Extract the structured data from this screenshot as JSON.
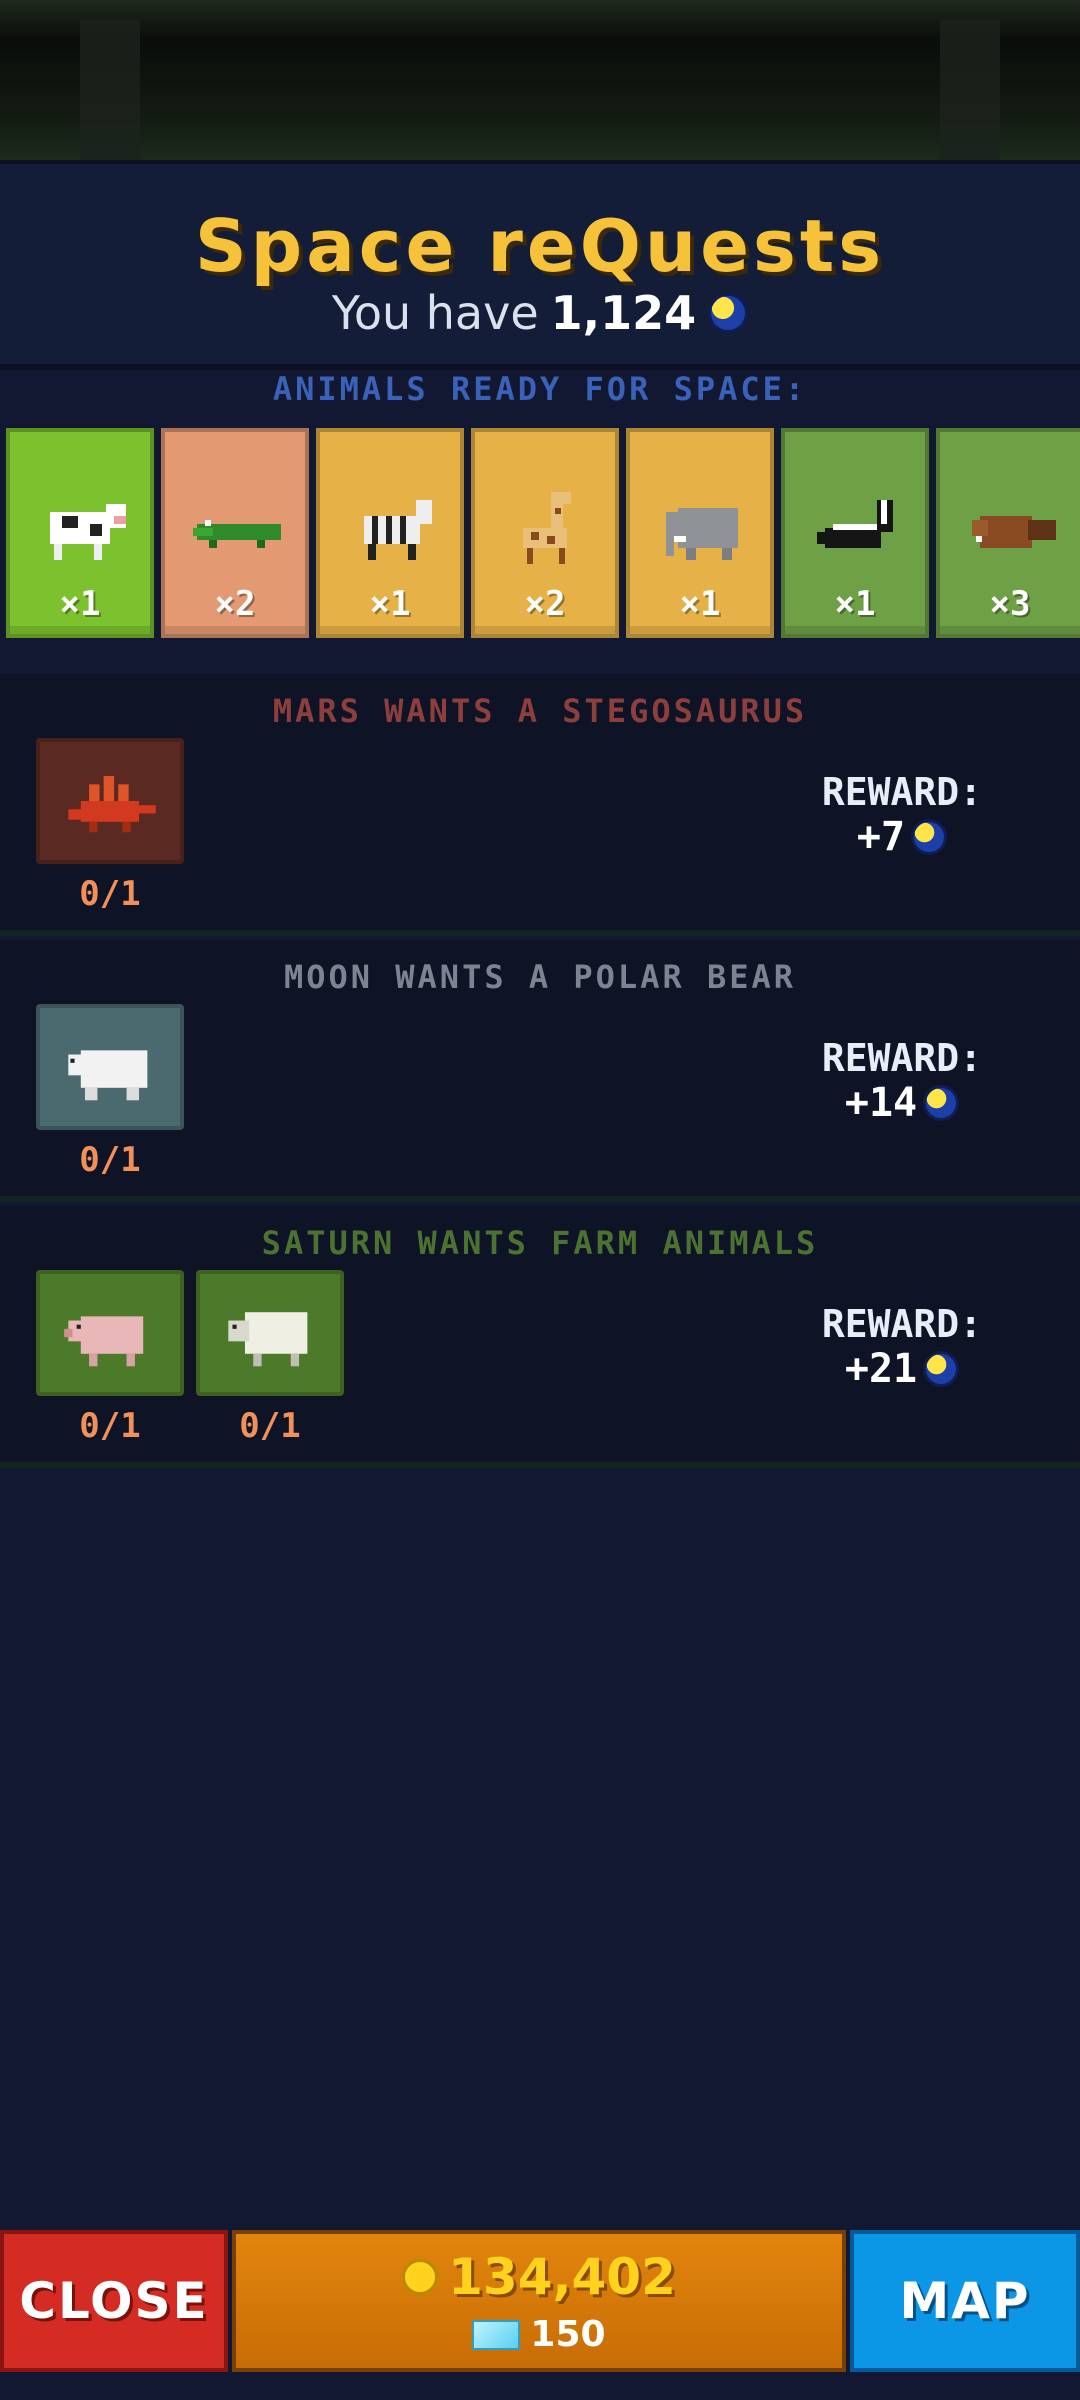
{
  "header": {
    "title": "Space reQuests",
    "balance_prefix": "You have",
    "balance_amount": "1,124"
  },
  "animals": {
    "label": "ANIMALS READY FOR SPACE:",
    "items": [
      {
        "name": "cow",
        "count": "×1",
        "color": "#7cc22e"
      },
      {
        "name": "crocodile",
        "count": "×2",
        "color": "#e39a73"
      },
      {
        "name": "zebra",
        "count": "×1",
        "color": "#e6b247"
      },
      {
        "name": "giraffe",
        "count": "×2",
        "color": "#e6b247"
      },
      {
        "name": "elephant",
        "count": "×1",
        "color": "#e6b247"
      },
      {
        "name": "skunk",
        "count": "×1",
        "color": "#6ea146"
      },
      {
        "name": "beaver",
        "count": "×3",
        "color": "#6ea146"
      }
    ]
  },
  "quests": [
    {
      "title": "MARS WANTS A STEGOSAURUS",
      "title_color": "#8d3f3d",
      "items": [
        {
          "animal": "stegosaurus",
          "progress": "0/1",
          "bg": "#5a2a22"
        }
      ],
      "reward_label": "REWARD:",
      "reward_value": "+7"
    },
    {
      "title": "MOON WANTS A POLAR BEAR",
      "title_color": "#7d8390",
      "items": [
        {
          "animal": "polar-bear",
          "progress": "0/1",
          "bg": "#4a6a70"
        }
      ],
      "reward_label": "REWARD:",
      "reward_value": "+14"
    },
    {
      "title": "SATURN WANTS FARM ANIMALS",
      "title_color": "#4c7232",
      "items": [
        {
          "animal": "pig",
          "progress": "0/1",
          "bg": "#4c7a2a"
        },
        {
          "animal": "sheep",
          "progress": "0/1",
          "bg": "#4c7a2a"
        }
      ],
      "reward_label": "REWARD:",
      "reward_value": "+21"
    }
  ],
  "bottom": {
    "close_label": "CLOSE",
    "gold": "134,402",
    "gems": "150",
    "map_label": "MAP"
  },
  "icons": {
    "space_coin": "space-coin-icon",
    "gold_coin": "gold-coin-icon",
    "gem": "gem-icon"
  }
}
